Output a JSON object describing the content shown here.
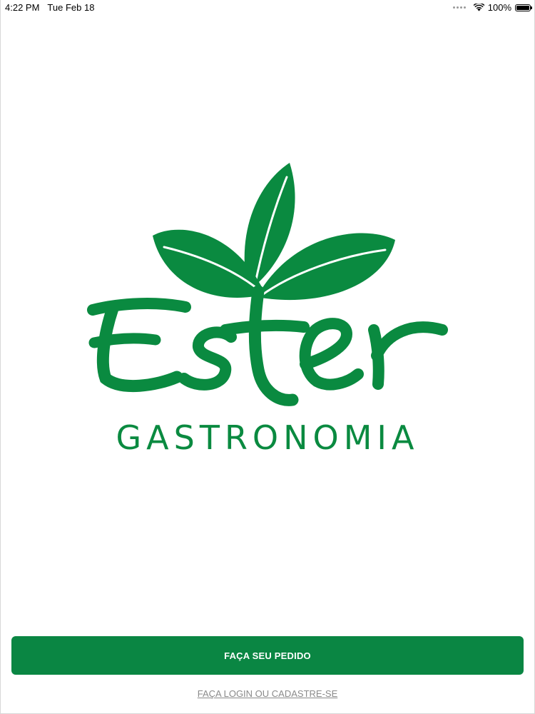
{
  "status_bar": {
    "time": "4:22 PM",
    "date": "Tue Feb 18",
    "battery": "100%",
    "icons": [
      "cellular-dots-icon",
      "wifi-icon",
      "battery-icon"
    ]
  },
  "logo": {
    "script_name": "Ester",
    "subtitle": "GASTRONOMIA",
    "icon": "sprout-leaves-icon",
    "color": "#0a8a40"
  },
  "actions": {
    "order_label": "FAÇA SEU PEDIDO",
    "login_label": "FAÇA LOGIN OU CADASTRE-SE",
    "button_color": "#0a8643"
  }
}
